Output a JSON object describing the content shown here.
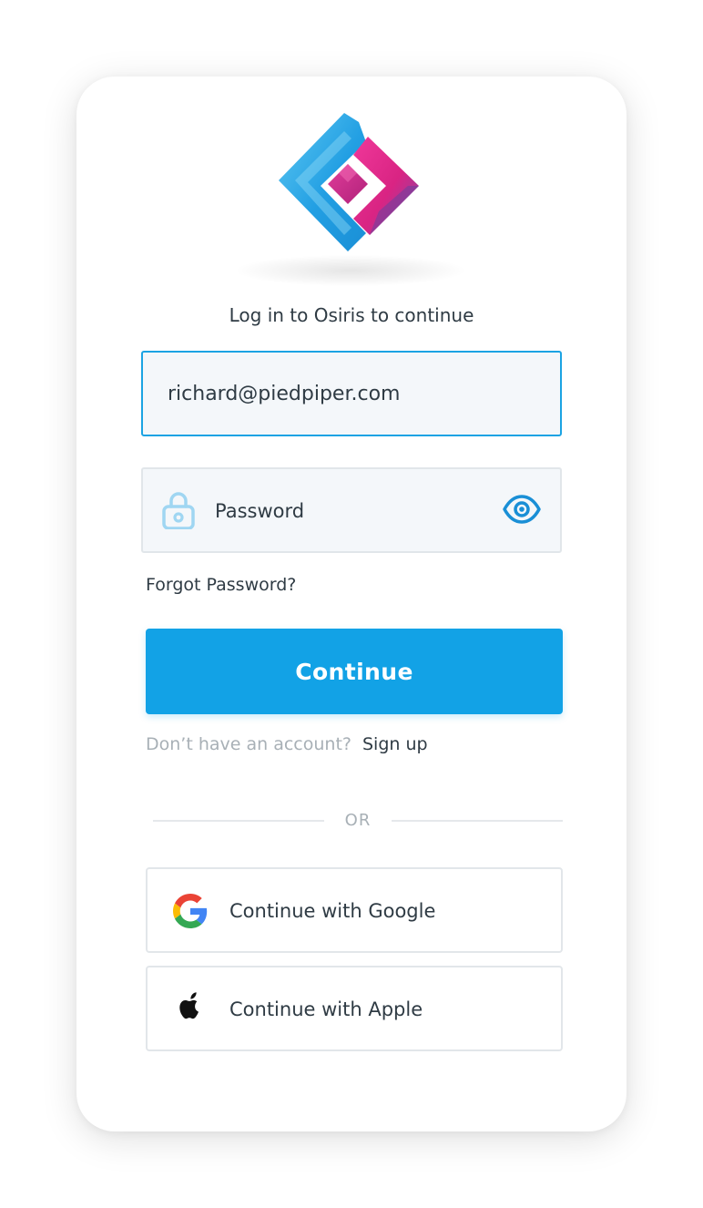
{
  "app": {
    "name": "Osiris"
  },
  "login": {
    "title": "Log in to Osiris to continue",
    "email_value": "richard@piedpiper.com",
    "password_placeholder": "Password",
    "forgot_password": "Forgot Password?",
    "continue_label": "Continue",
    "no_account_text": "Don’t have an account?",
    "signup_label": "Sign up",
    "or_label": "OR",
    "google_label": "Continue with Google",
    "apple_label": "Continue with Apple"
  },
  "icons": {
    "logo": "osiris-logo",
    "lock": "lock-icon",
    "eye": "eye-icon",
    "google": "google-icon",
    "apple": "apple-icon"
  },
  "colors": {
    "accent": "#12a2e6",
    "focus_border": "#1ba3e3",
    "text": "#2f3b44",
    "muted": "#a8b0b6",
    "field_background": "#f4f7fa"
  }
}
